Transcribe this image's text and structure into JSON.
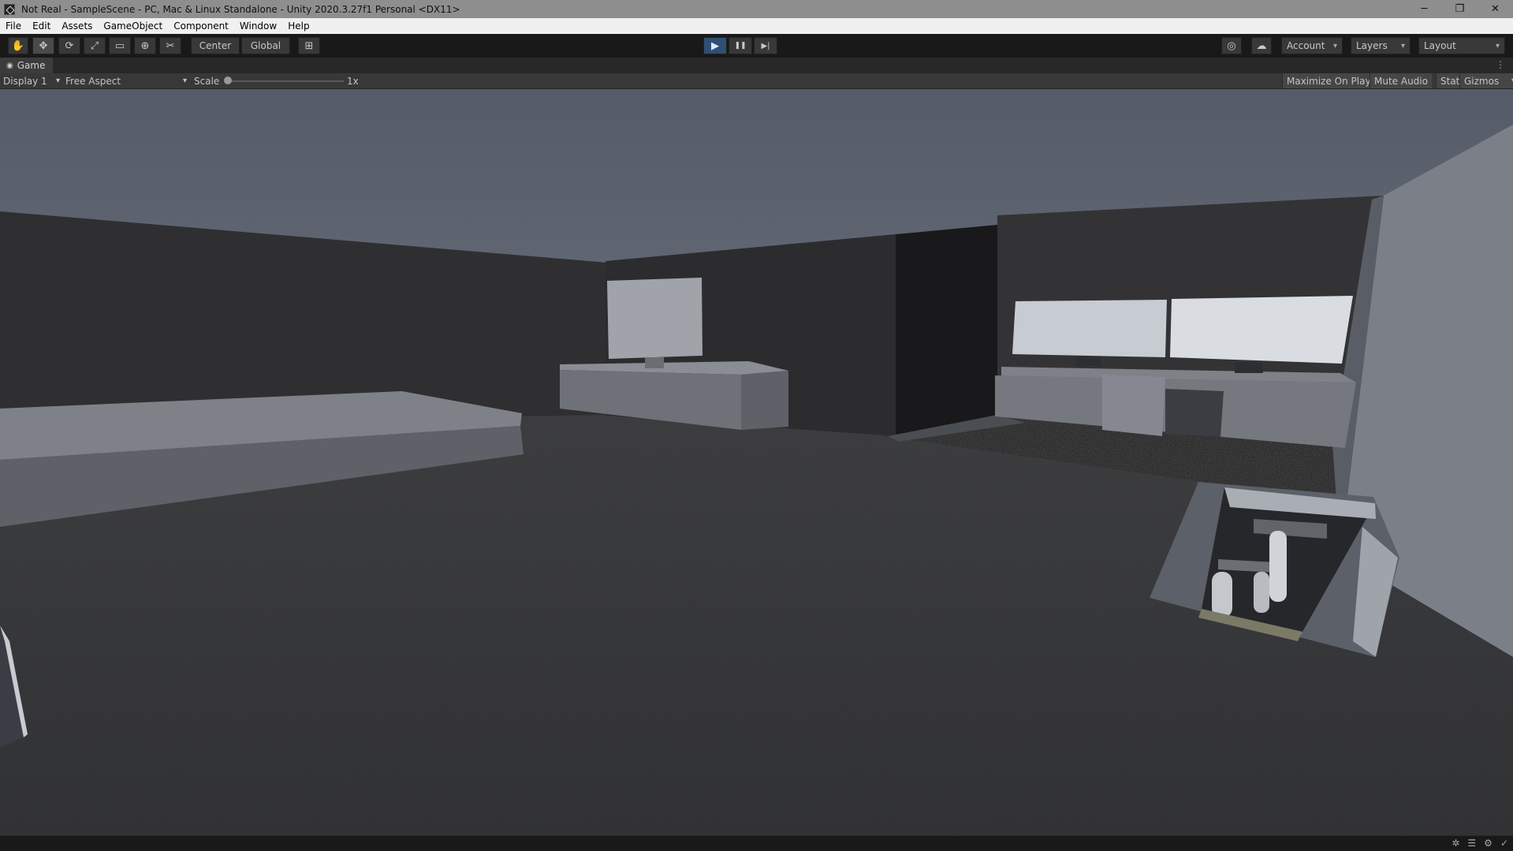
{
  "window": {
    "title": "Not Real - SampleScene - PC, Mac & Linux Standalone - Unity 2020.3.27f1 Personal <DX11>",
    "minimize": "─",
    "restore": "❐",
    "close": "✕"
  },
  "menu": [
    "File",
    "Edit",
    "Assets",
    "GameObject",
    "Component",
    "Window",
    "Help"
  ],
  "toolbar": {
    "pivot_mode": "Center",
    "pivot_rotation": "Global",
    "account": "Account",
    "layers": "Layers",
    "layout": "Layout"
  },
  "tabs": {
    "game": "Game"
  },
  "game_view": {
    "display": "Display 1",
    "aspect": "Free Aspect",
    "scale_label": "Scale",
    "scale_value": "1x",
    "maximize_on_play": "Maximize On Play",
    "mute_audio": "Mute Audio",
    "stats": "Stats",
    "gizmos": "Gizmos"
  },
  "icons": {
    "hand": "✋",
    "move": "✥",
    "rotate": "⟳",
    "scale": "⤢",
    "rect": "▭",
    "transform": "⊕",
    "custom": "✂",
    "grid": "⊞",
    "play": "▶",
    "pause": "❚❚",
    "step": "▶|",
    "collab": "◎",
    "cloud": "☁",
    "game": "◉",
    "more": "⋮",
    "dropdown": "▾"
  },
  "colors": {
    "play_active": "#2f4f74",
    "wall_dark": "#2e2e30",
    "floor": "#3a3b3e",
    "sky": "#545b66"
  }
}
